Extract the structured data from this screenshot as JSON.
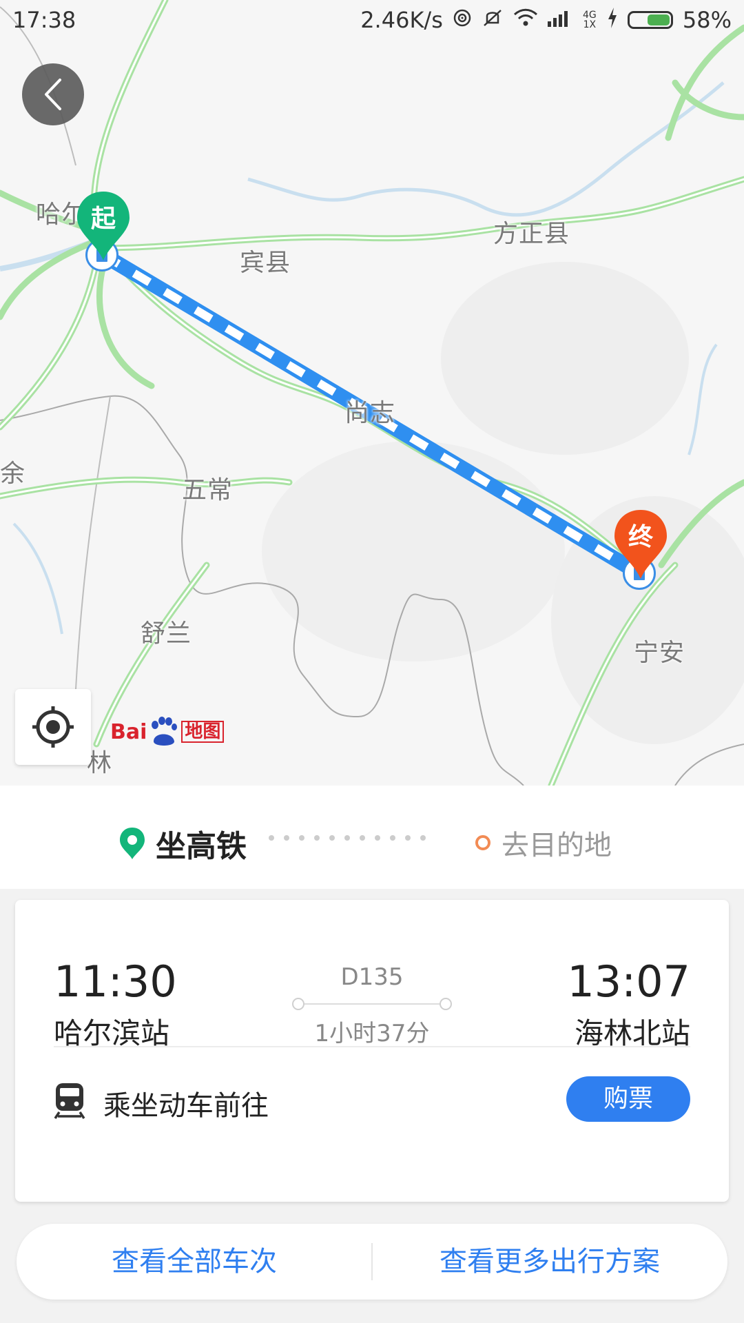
{
  "status_bar": {
    "time": "17:38",
    "net_speed": "2.46K/s",
    "battery_percent": "58%",
    "battery_level": 0.58,
    "network_label": "4G 1X",
    "icons": [
      "hotspot-icon",
      "mute-icon",
      "wifi-icon",
      "signal-icon",
      "charging-icon",
      "battery-icon"
    ]
  },
  "map": {
    "places": {
      "harbin": "哈尔滨",
      "binxian": "宾县",
      "fangzheng": "方正县",
      "shangzhi": "尚志",
      "wuchang": "五常",
      "shulan": "舒兰",
      "ningan": "宁安",
      "yushu": "余",
      "lin": "林"
    },
    "start_pin": "起",
    "end_pin": "终",
    "brand": {
      "bai": "Bai",
      "du": "du",
      "map_text": "地图"
    },
    "colors": {
      "route_blue": "#2f8ff0",
      "start_green": "#13b57a",
      "end_orange": "#f2531c",
      "road_green": "#a6e0a0"
    }
  },
  "segment": {
    "mode_label": "坐高铁",
    "destination_label": "去目的地"
  },
  "train": {
    "departure_time": "11:30",
    "departure_station": "哈尔滨站",
    "train_number": "D135",
    "duration": "1小时37分",
    "arrival_time": "13:07",
    "arrival_station": "海林北站",
    "ride_label": "乘坐动车前往",
    "buy_label": "购票"
  },
  "actions": {
    "all_trains": "查看全部车次",
    "more_plans": "查看更多出行方案"
  }
}
